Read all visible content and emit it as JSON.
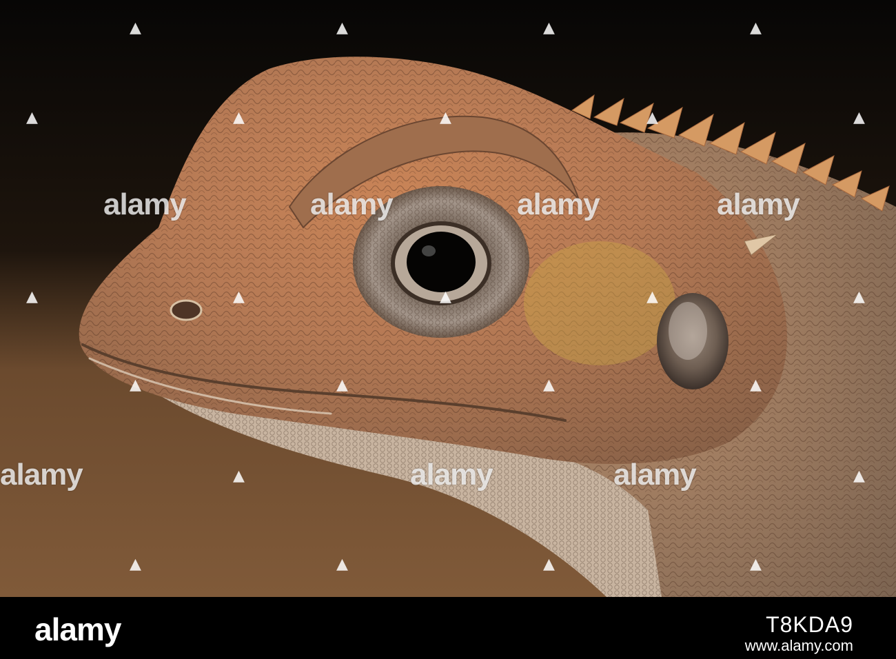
{
  "photo": {
    "subject": "lizard-head",
    "palette": {
      "background_top": "#0b0907",
      "background_bottom": "#7a5636",
      "skin_orange": "#c8794e",
      "skin_tan": "#b8906c",
      "skin_yellow": "#c9a24a",
      "eye_ring": "#8e7f70",
      "pupil": "#050403",
      "throat": "#cbbcab"
    }
  },
  "watermark": {
    "word": "alamy",
    "dot_glyph": "▲"
  },
  "footer": {
    "logo_text": "alamy",
    "image_id": "T8KDA9",
    "url": "www.alamy.com"
  }
}
